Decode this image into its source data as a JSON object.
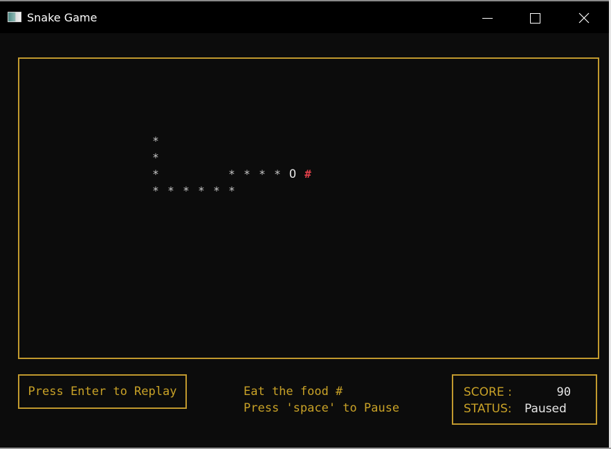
{
  "window": {
    "title": "Snake Game",
    "icon": "console-window-icon",
    "controls": [
      "minimize",
      "maximize",
      "close"
    ]
  },
  "colors": {
    "border": "#c29a2e",
    "text_accent": "#c9a227",
    "snake": "#c8c8c8",
    "food": "#e0404a",
    "background": "#0c0c0c"
  },
  "board": {
    "snake_body_glyph": "*",
    "snake_head_glyph": "O",
    "food_glyph": "#",
    "cells": [
      {
        "type": "body",
        "col": 0,
        "row": 0
      },
      {
        "type": "body",
        "col": 0,
        "row": 1
      },
      {
        "type": "body",
        "col": 0,
        "row": 2
      },
      {
        "type": "body",
        "col": 0,
        "row": 3
      },
      {
        "type": "body",
        "col": 1,
        "row": 3
      },
      {
        "type": "body",
        "col": 2,
        "row": 3
      },
      {
        "type": "body",
        "col": 3,
        "row": 3
      },
      {
        "type": "body",
        "col": 4,
        "row": 3
      },
      {
        "type": "body",
        "col": 5,
        "row": 3
      },
      {
        "type": "body",
        "col": 5,
        "row": 2
      },
      {
        "type": "body",
        "col": 6,
        "row": 2
      },
      {
        "type": "body",
        "col": 7,
        "row": 2
      },
      {
        "type": "body",
        "col": 8,
        "row": 2
      },
      {
        "type": "head",
        "col": 9,
        "row": 2
      },
      {
        "type": "food",
        "col": 10,
        "row": 2
      }
    ]
  },
  "replay_button": {
    "label": "Press Enter to Replay"
  },
  "hints": {
    "line1": "Eat the food #",
    "line2": "Press 'space' to Pause"
  },
  "scoreboard": {
    "score_label": "SCORE :",
    "score_value": "90",
    "status_label": "STATUS:",
    "status_value": "Paused"
  }
}
